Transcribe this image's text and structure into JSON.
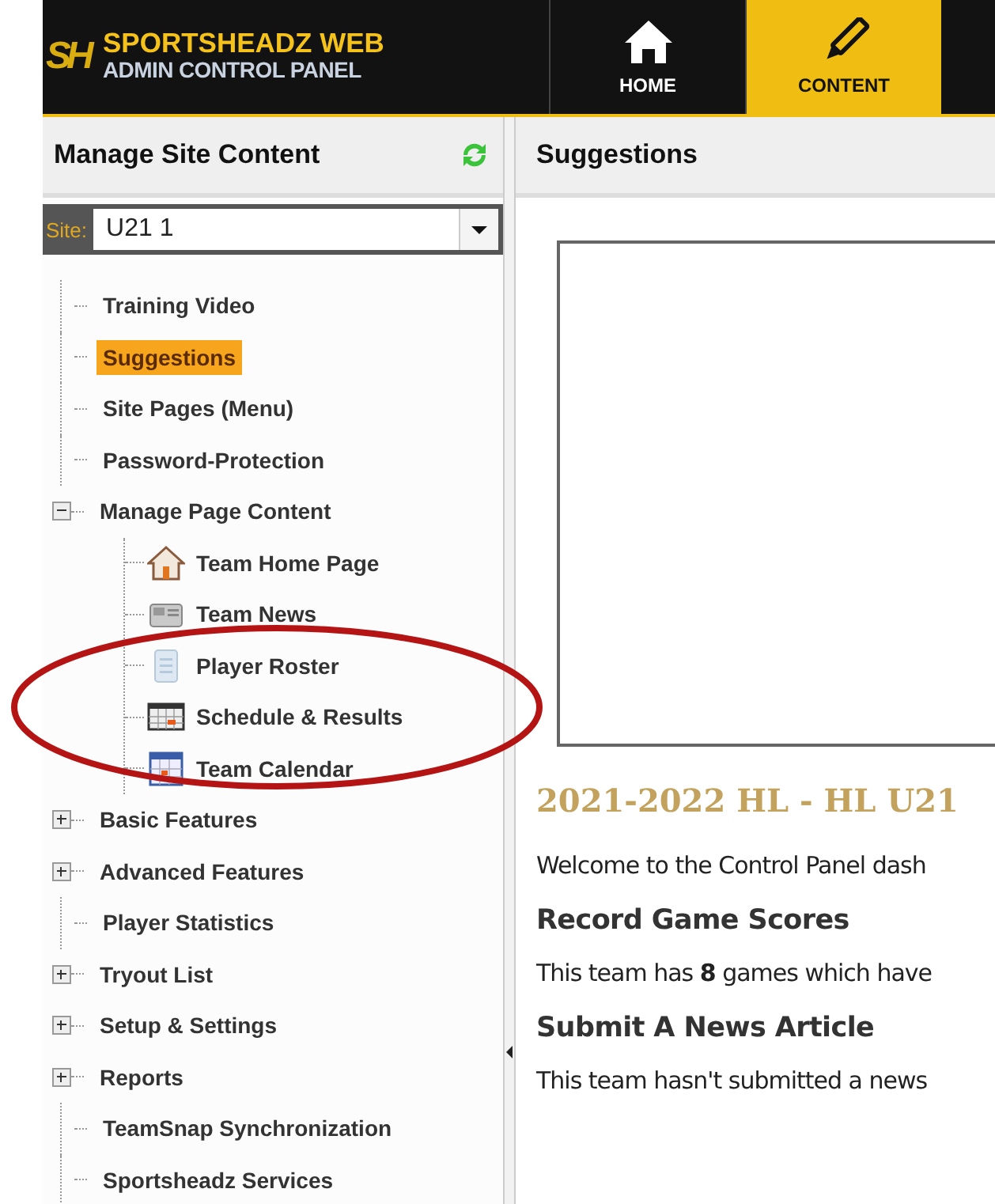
{
  "header": {
    "logo_mark": "SH",
    "title": "SPORTSHEADZ WEB",
    "subtitle": "ADMIN CONTROL PANEL",
    "tabs": [
      {
        "label": "HOME",
        "kind": "home",
        "selected": false
      },
      {
        "label": "CONTENT",
        "kind": "pencil",
        "selected": true
      }
    ]
  },
  "sidebar": {
    "title": "Manage Site Content",
    "site_label": "Site:",
    "site_value": "U21 1",
    "items": [
      {
        "label": "Training Video",
        "selected": false
      },
      {
        "label": "Suggestions",
        "selected": true
      },
      {
        "label": "Site Pages (Menu)",
        "selected": false
      },
      {
        "label": "Password-Protection",
        "selected": false
      },
      {
        "label": "Manage Page Content",
        "selected": false,
        "expanded": true,
        "children": [
          {
            "label": "Team Home Page",
            "kind": "home",
            "selected": false
          },
          {
            "label": "Team News",
            "kind": "news",
            "selected": false
          },
          {
            "label": "Player Roster",
            "kind": "roster",
            "selected": false
          },
          {
            "label": "Schedule & Results",
            "kind": "schedule",
            "selected": false
          },
          {
            "label": "Team Calendar",
            "kind": "calendar",
            "selected": false
          }
        ]
      },
      {
        "label": "Basic Features",
        "selected": false,
        "expanded": false
      },
      {
        "label": "Advanced Features",
        "selected": false,
        "expanded": false
      },
      {
        "label": "Player Statistics",
        "selected": false
      },
      {
        "label": "Tryout List",
        "selected": false,
        "expanded": false
      },
      {
        "label": "Setup & Settings",
        "selected": false,
        "expanded": false
      },
      {
        "label": "Reports",
        "selected": false,
        "expanded": false
      },
      {
        "label": "TeamSnap Synchronization",
        "selected": false
      },
      {
        "label": "Sportsheadz Services",
        "selected": false
      }
    ]
  },
  "main": {
    "title": "Suggestions",
    "headline": "2021-2022 HL - HL U21",
    "blocks": [
      {
        "kind": "text",
        "text": "Welcome to the Control Panel dash"
      },
      {
        "kind": "heading",
        "text": "Record Game Scores"
      },
      {
        "kind": "text",
        "text": "This team has **8** games which have"
      },
      {
        "kind": "heading",
        "text": "Submit A News Article"
      },
      {
        "kind": "text",
        "text": "This team hasn't submitted a news"
      }
    ]
  }
}
